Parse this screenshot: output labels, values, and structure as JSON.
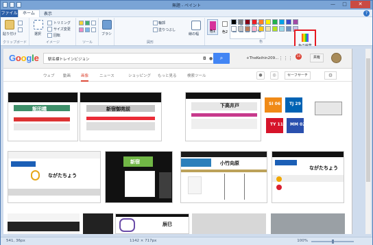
{
  "window": {
    "title": "無題 - ペイント",
    "buttons": [
      "—",
      "□",
      "✕"
    ]
  },
  "menu": {
    "file": "ファイル",
    "tabs": [
      "ホーム",
      "表示"
    ]
  },
  "ribbon": {
    "paste_label": "貼り付け",
    "clipboard_group": "クリップボード",
    "image_group": "イメージ",
    "select_label": "選択",
    "crop_label": "トリミング",
    "resize_label": "サイズ変更",
    "rotate_label": "回転",
    "tools_group": "ツール",
    "brush_label": "ブラシ",
    "shapes_group": "図形",
    "outline_label": "輪郭",
    "fill_label": "塗りつぶし",
    "size_label": "線の幅",
    "color1_label": "色1",
    "color2_label": "色2",
    "colors_group": "色",
    "edit_colors": "色の編集",
    "palette": [
      "#000000",
      "#7f7f7f",
      "#880015",
      "#ed1c24",
      "#ff7f27",
      "#fff200",
      "#22b14c",
      "#00a2e8",
      "#3f48cc",
      "#a349a4",
      "#ffffff",
      "#c3c3c3",
      "#b97a57",
      "#ffaec9",
      "#ffc90e",
      "#efe4b0",
      "#b5e61d",
      "#99d9ea",
      "#7092be",
      "#c8bfe7"
    ]
  },
  "google": {
    "logo": "Google",
    "query": "駅名標トレインビジョン",
    "search_icon": "search-icon",
    "user": "+TheKeihin209...",
    "notifications": "10",
    "share": "共有",
    "tabs": [
      "ウェブ",
      "動画",
      "画像",
      "ニュース",
      "ショッピング",
      "もっと見る",
      "検索ツール"
    ],
    "active_tab": "画像",
    "safe_search": "セーフサーチ",
    "images": [
      {
        "title": "飯田橋"
      },
      {
        "title": "新宿御苑前"
      },
      {
        "title": "下高井戸"
      },
      {
        "title": "SI 06"
      },
      {
        "title": "TJ 29"
      },
      {
        "title": "TY 11"
      },
      {
        "title": "MM 02"
      },
      {
        "title": "ながたちょう"
      },
      {
        "title": "新宿"
      },
      {
        "title": "小竹向原"
      },
      {
        "title": "ながたちょう"
      },
      {
        "title": "辰巳"
      }
    ]
  },
  "status": {
    "coords": "541, 36px",
    "size": "1142 × 717px",
    "zoom": "100%"
  }
}
